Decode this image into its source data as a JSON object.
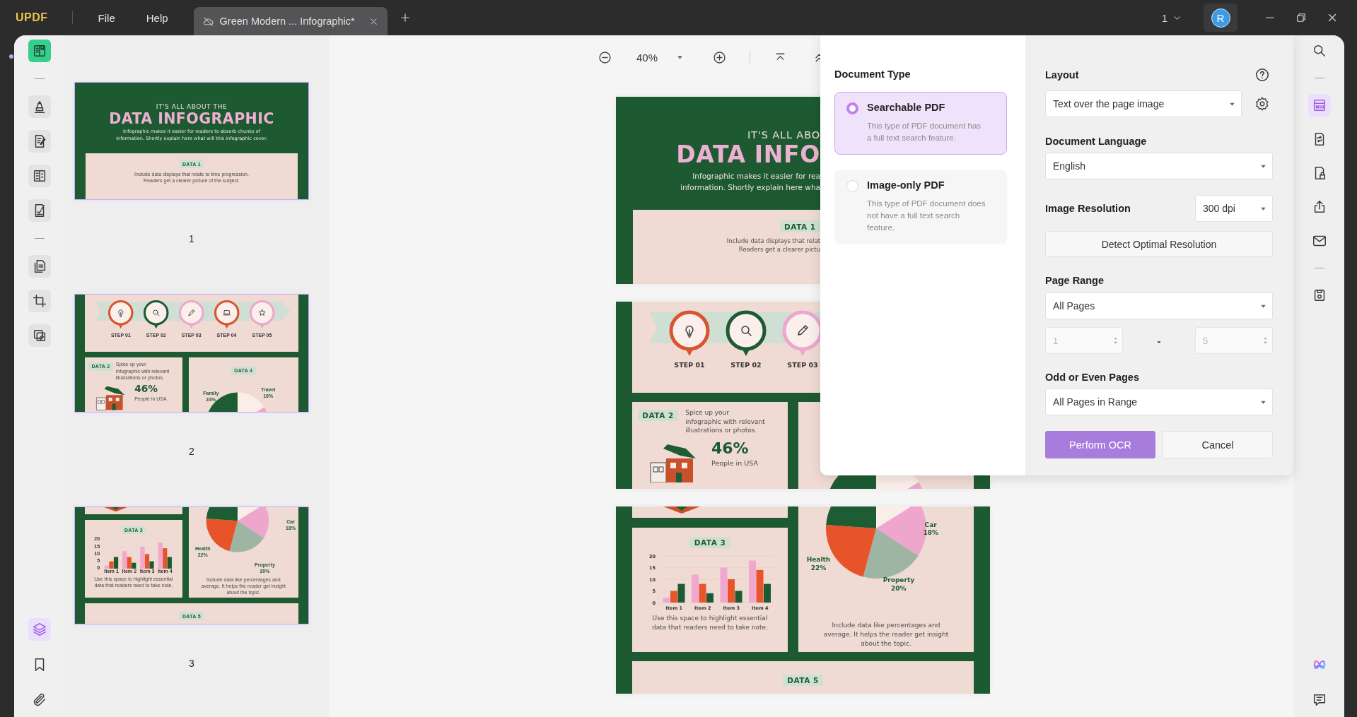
{
  "app": {
    "logo": "UPDF",
    "menu": [
      "File",
      "Help"
    ]
  },
  "tabs": [
    {
      "title": "Green Modern ... Infographic*",
      "selected": true
    }
  ],
  "window": {
    "count": "1",
    "avatar": "R"
  },
  "left_toolbar": {
    "groups": [
      [
        {
          "kind": "reader",
          "selected": true
        }
      ],
      [
        {
          "kind": "highlight",
          "selected": false
        },
        {
          "kind": "edit",
          "selected": false
        },
        {
          "kind": "form",
          "selected": false
        },
        {
          "kind": "sign",
          "selected": false
        }
      ],
      [
        {
          "kind": "pages",
          "selected": false
        },
        {
          "kind": "crop",
          "selected": false
        },
        {
          "kind": "stack",
          "selected": false
        }
      ]
    ],
    "bottom": [
      {
        "kind": "layers",
        "selected": true
      },
      {
        "kind": "bookmark",
        "selected": false
      },
      {
        "kind": "attach",
        "selected": false
      }
    ]
  },
  "thumbnails": [
    {
      "label": "1",
      "page": {
        "kind": "cover",
        "kicker": "IT'S ALL ABOUT THE",
        "title": "DATA INFOGRAPHIC",
        "intro": "Infographic makes it easier for readers to absorb chunks of\ninformation. Shortly explain here what will this infographic cover.",
        "tag": "DATA 1",
        "text": "Include data displays that relate to time progression.\nReaders get a clearer picture of the subject."
      }
    },
    {
      "label": "2",
      "page": {
        "kind": "steps",
        "steps": [
          {
            "kind": "bulb",
            "color": "#d8552f",
            "label": "STEP 01"
          },
          {
            "kind": "search",
            "color": "#1f5a35",
            "label": "STEP 02"
          },
          {
            "kind": "pencil",
            "color": "#eda7cf",
            "label": "STEP 03"
          },
          {
            "kind": "laptop",
            "color": "#d8552f",
            "label": "STEP 04"
          },
          {
            "kind": "star",
            "color": "#eda7cf",
            "label": "STEP 05"
          }
        ],
        "data2": {
          "tag": "DATA 2",
          "text": "Spice up your\ninfographic with relevant\nillustrations or photos.",
          "stat": "46%",
          "stat_label": "People in USA"
        },
        "data4": {
          "tag": "DATA 4",
          "labels": [
            "Family\n24%",
            "Travel\n16%"
          ]
        }
      }
    },
    {
      "label": "3",
      "page": {
        "kind": "charts",
        "data3": {
          "tag": "DATA 3",
          "chart_data": {
            "type": "bar",
            "categories": [
              "Item 1",
              "Item 2",
              "Item 3",
              "Item 4"
            ],
            "series": [
              {
                "color": "#f0a8cf",
                "values": [
                  2,
                  12,
                  15,
                  18
                ]
              },
              {
                "color": "#e8552b",
                "values": [
                  5,
                  8,
                  10,
                  14
                ]
              },
              {
                "color": "#1d5a32",
                "values": [
                  8,
                  4,
                  5,
                  8
                ]
              }
            ],
            "ylim": [
              0,
              20
            ],
            "yticks": [
              0,
              5,
              10,
              15,
              20
            ]
          },
          "caption": "Use this space to highlight essential\ndata that readers need to take note."
        },
        "pie": {
          "labels": [
            "Car\n18%",
            "Health\n22%",
            "Property\n20%"
          ],
          "caption": "Include data like percentages and\naverage. It helps the reader get insight\nabout the topic."
        },
        "data5": {
          "tag": "DATA 5"
        }
      }
    }
  ],
  "viewer": {
    "zoom": "40%",
    "pages": [
      {
        "kind": "cover",
        "kicker": "IT'S ALL ABO",
        "title": "DATA INFO",
        "intro": "Infographic makes it easier for rea\ninformation. Shortly explain here wha",
        "tag": "DATA 1",
        "text": "Include data displays that relat\nReaders get a clearer pictu"
      },
      {
        "kind": "steps",
        "steps": [
          {
            "kind": "bulb",
            "color": "#d8552f",
            "label": "STEP 01"
          },
          {
            "kind": "search",
            "color": "#1f5a35",
            "label": "STEP 02"
          },
          {
            "kind": "pencil",
            "color": "#eda7cf",
            "label": "STEP 03"
          }
        ],
        "data2": {
          "tag": "DATA 2",
          "text": "Spice up your\ninfographic with relevant\nillustrations or photos.",
          "stat": "46%",
          "stat_label": "People in USA"
        }
      },
      {
        "kind": "charts",
        "data3": {
          "tag": "DATA 3",
          "chart_data": {
            "type": "bar",
            "categories": [
              "Item 1",
              "Item 2",
              "Item 3",
              "Item 4"
            ],
            "series": [
              {
                "color": "#f0a8cf",
                "values": [
                  2,
                  12,
                  15,
                  18
                ]
              },
              {
                "color": "#e8552b",
                "values": [
                  5,
                  8,
                  10,
                  14
                ]
              },
              {
                "color": "#1d5a32",
                "values": [
                  8,
                  4,
                  5,
                  8
                ]
              }
            ],
            "ylim": [
              0,
              20
            ],
            "yticks": [
              0,
              5,
              10,
              15,
              20
            ]
          },
          "caption": "Use this space to highlight essential\ndata that readers need to take note."
        },
        "pie": {
          "labels": [
            "Car\n18%",
            "Health\n22%",
            "Property\n20%"
          ],
          "caption": "Include data like percentages and\naverage. It helps the reader get insight\nabout the topic."
        },
        "data5": {
          "tag": "DATA 5"
        }
      }
    ]
  },
  "ocr_panel": {
    "document_type": {
      "label": "Document Type",
      "options": [
        {
          "title": "Searchable PDF",
          "description": "This type of PDF document has a full text search feature.",
          "selected": true
        },
        {
          "title": "Image-only PDF",
          "description": "This type of PDF document does not have a full text search feature.",
          "selected": false
        }
      ]
    },
    "layout": {
      "label": "Layout",
      "value": "Text over the page image"
    },
    "document_language": {
      "label": "Document Language",
      "value": "English"
    },
    "image_resolution": {
      "label": "Image Resolution",
      "value": "300 dpi",
      "button": "Detect Optimal Resolution"
    },
    "page_range": {
      "label": "Page Range",
      "value": "All Pages",
      "from": "1",
      "to": "5",
      "separator": "-",
      "disabled": true
    },
    "odd_even": {
      "label": "Odd or Even Pages",
      "value": "All Pages in Range"
    },
    "buttons": {
      "primary": "Perform OCR",
      "cancel": "Cancel"
    }
  },
  "right_toolbar": {
    "groups": [
      [
        {
          "kind": "search",
          "selected": false
        }
      ],
      [
        {
          "kind": "ocr",
          "selected": true
        },
        {
          "kind": "convert",
          "selected": false
        },
        {
          "kind": "protect",
          "selected": false
        },
        {
          "kind": "share",
          "selected": false
        },
        {
          "kind": "email",
          "selected": false
        }
      ],
      [
        {
          "kind": "save",
          "selected": false
        }
      ]
    ],
    "bottom": [
      {
        "kind": "ai",
        "selected": false
      },
      {
        "kind": "comment",
        "selected": false
      }
    ]
  }
}
